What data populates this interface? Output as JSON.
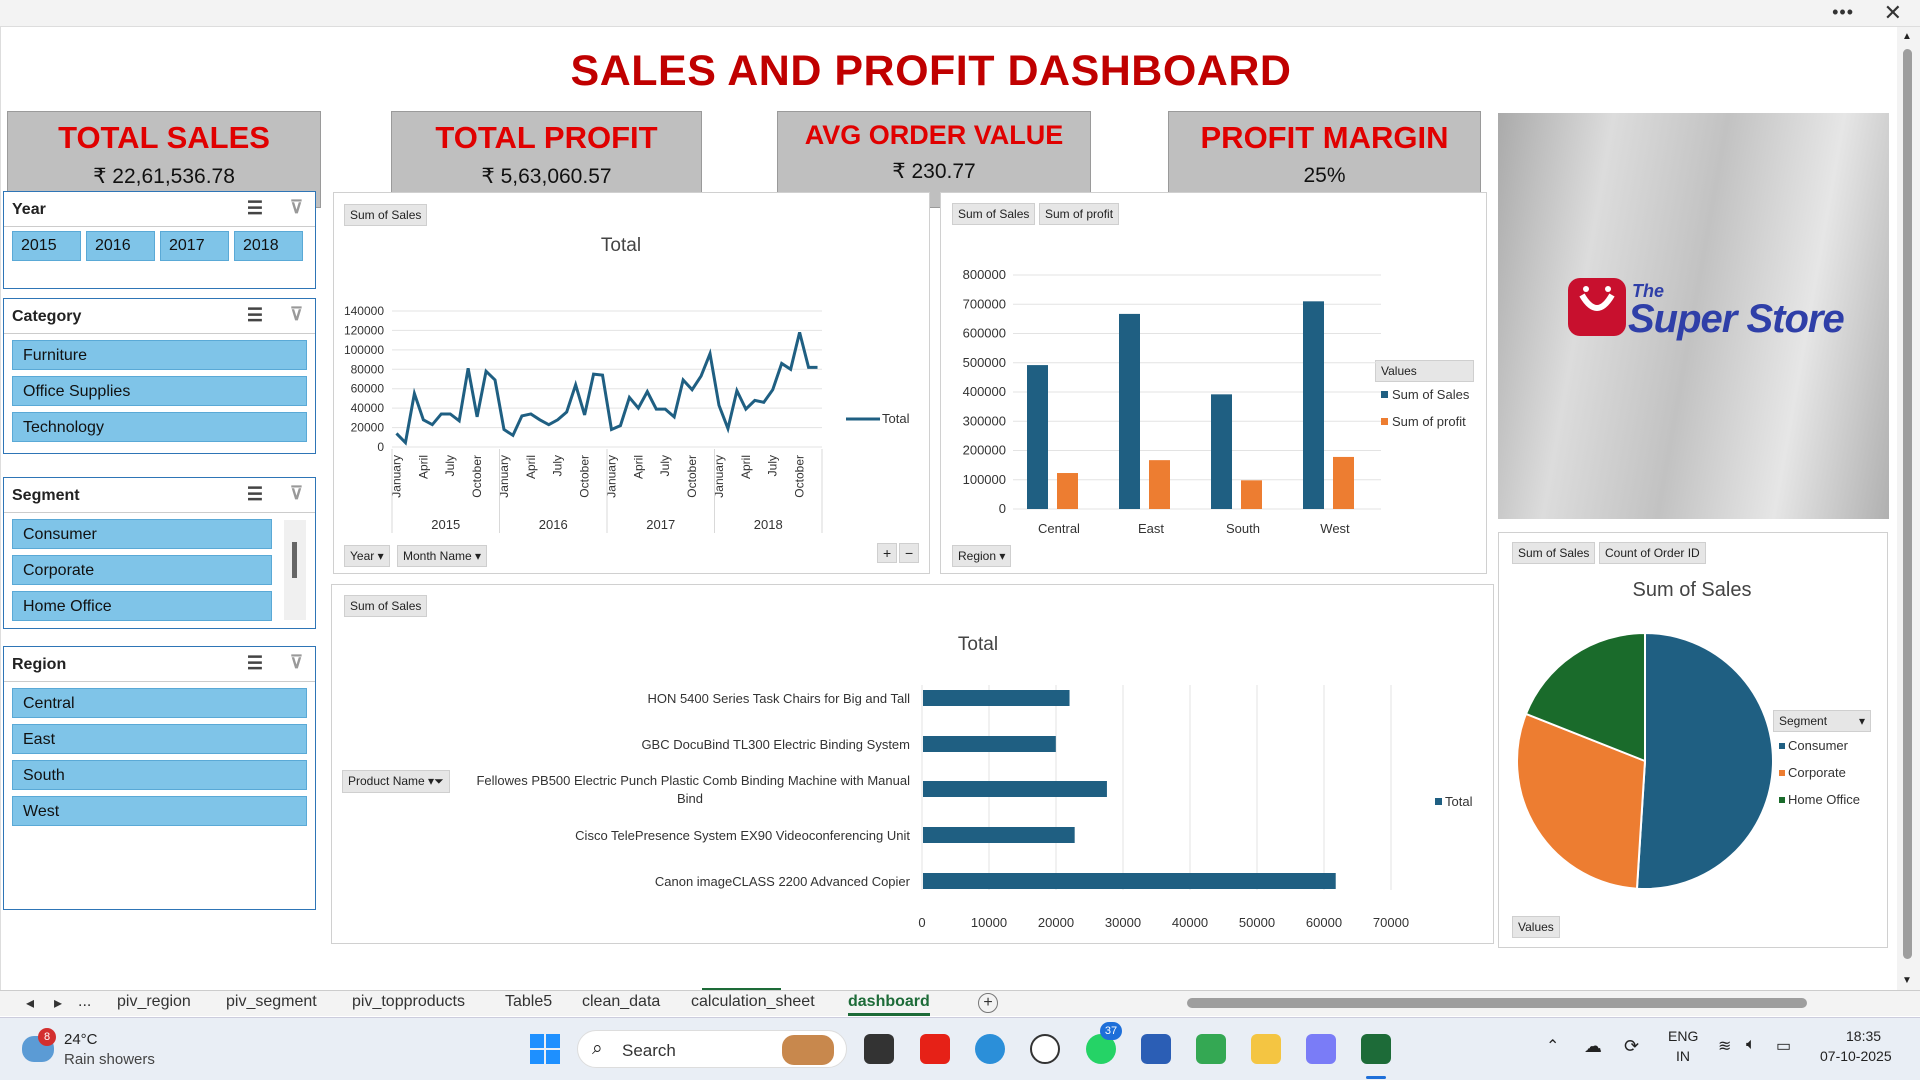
{
  "title": "SALES AND PROFIT DASHBOARD",
  "kpis": [
    {
      "label": "TOTAL SALES",
      "value": "₹ 22,61,536.78"
    },
    {
      "label": "TOTAL PROFIT",
      "value": "₹ 5,63,060.57"
    },
    {
      "label": "AVG ORDER VALUE",
      "value": "₹ 230.77"
    },
    {
      "label": "PROFIT MARGIN",
      "value": "25%"
    }
  ],
  "slicers": {
    "year": {
      "title": "Year",
      "items": [
        "2015",
        "2016",
        "2017",
        "2018"
      ]
    },
    "category": {
      "title": "Category",
      "items": [
        "Furniture",
        "Office Supplies",
        "Technology"
      ]
    },
    "segment": {
      "title": "Segment",
      "items": [
        "Consumer",
        "Corporate",
        "Home Office"
      ]
    },
    "region": {
      "title": "Region",
      "items": [
        "Central",
        "East",
        "South",
        "West"
      ]
    }
  },
  "logo": {
    "the": "The",
    "name": "Super Store"
  },
  "line_panel": {
    "field_pill": "Sum of Sales",
    "filter_year": "Year",
    "filter_month": "Month Name",
    "plus": "+",
    "minus": "−"
  },
  "bar_panel": {
    "pill1": "Sum of Sales",
    "pill2": "Sum of profit",
    "filter": "Region",
    "legend_title": "Values"
  },
  "hbar_panel": {
    "field_pill": "Sum of Sales",
    "row_filter": "Product Name"
  },
  "pie_panel": {
    "pill1": "Sum of Sales",
    "pill2": "Count of Order ID",
    "legend_title": "Segment",
    "values_pill": "Values"
  },
  "chart_data": [
    {
      "type": "line",
      "title": "Total",
      "legend": [
        "Total"
      ],
      "years": [
        "2015",
        "2016",
        "2017",
        "2018"
      ],
      "month_tick_labels": [
        "January",
        "April",
        "July",
        "October"
      ],
      "ylim": [
        0,
        140000
      ],
      "yticks": [
        "140000",
        "120000",
        "100000",
        "80000",
        "60000",
        "40000",
        "20000",
        "0"
      ],
      "series": [
        {
          "name": "Total",
          "values": [
            14000,
            4500,
            55000,
            28000,
            23000,
            34000,
            34000,
            27000,
            81000,
            31000,
            78000,
            69000,
            18000,
            12000,
            32000,
            34000,
            28000,
            23000,
            28000,
            36000,
            64000,
            33000,
            75000,
            74000,
            18000,
            22000,
            51000,
            40000,
            57000,
            39000,
            39000,
            31000,
            69000,
            59000,
            73000,
            96000,
            43000,
            19000,
            58000,
            39000,
            48000,
            46000,
            59000,
            86000,
            80000,
            118000,
            82000,
            82000
          ]
        }
      ],
      "color": "#1f5f82"
    },
    {
      "type": "bar",
      "categories": [
        "Central",
        "East",
        "South",
        "West"
      ],
      "ylim": [
        0,
        800000
      ],
      "yticks": [
        "800000",
        "700000",
        "600000",
        "500000",
        "400000",
        "300000",
        "200000",
        "100000",
        "0"
      ],
      "series": [
        {
          "name": "Sum of Sales",
          "values": [
            492000,
            667000,
            392000,
            710000
          ],
          "color": "#1f5f82"
        },
        {
          "name": "Sum of profit",
          "values": [
            123000,
            167000,
            98000,
            178000
          ],
          "color": "#ed7d31"
        }
      ]
    },
    {
      "type": "bar",
      "orientation": "horizontal",
      "title": "Total",
      "legend": [
        "Total"
      ],
      "categories": [
        "HON 5400 Series Task Chairs for Big and Tall",
        "GBC DocuBind TL300 Electric Binding System",
        "Fellowes PB500 Electric Punch Plastic Comb Binding Machine with Manual Bind",
        "Cisco TelePresence System EX90 Videoconferencing Unit",
        "Canon imageCLASS 2200 Advanced Copier"
      ],
      "values": [
        21870,
        19823,
        27453,
        22638,
        61600
      ],
      "xlim": [
        0,
        70000
      ],
      "xticks": [
        "0",
        "10000",
        "20000",
        "30000",
        "40000",
        "50000",
        "60000",
        "70000"
      ],
      "color": "#1f5f82"
    },
    {
      "type": "pie",
      "title": "Sum of Sales",
      "categories": [
        "Consumer",
        "Corporate",
        "Home Office"
      ],
      "values": [
        51,
        30,
        19
      ],
      "colors": [
        "#1f5f82",
        "#ed7d31",
        "#1a6b2b"
      ]
    }
  ],
  "sheet_tabs": [
    "piv_region",
    "piv_segment",
    "piv_topproducts",
    "Table5",
    "clean_data",
    "calculation_sheet",
    "dashboard"
  ],
  "tab_nav": {
    "prev": "◂",
    "next": "▸",
    "more": "...",
    "add": "+"
  },
  "taskbar": {
    "badge": "8",
    "temp": "24°C",
    "weather": "Rain showers",
    "search": "Search",
    "whatsapp_badge": "37",
    "lang1": "ENG",
    "lang2": "IN",
    "time": "18:35",
    "date": "07-10-2025"
  }
}
